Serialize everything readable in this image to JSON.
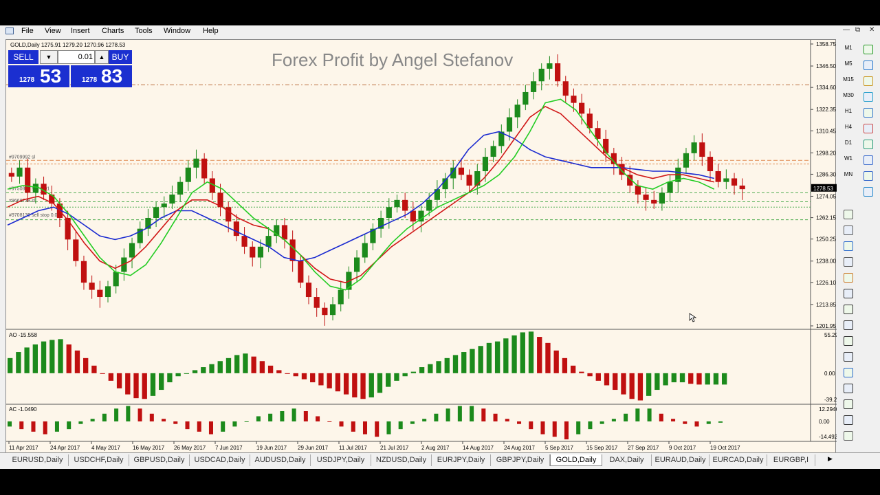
{
  "menu": {
    "items": [
      "File",
      "View",
      "Insert",
      "Charts",
      "Tools",
      "Window",
      "Help"
    ]
  },
  "symbol_header": "GOLD,Daily  1275.91 1279.20 1270.96 1278.53",
  "watermark": "Forex Profit by Angel Stefanov",
  "trade_panel": {
    "sell_label": "SELL",
    "buy_label": "BUY",
    "lot": "0.01",
    "sell_prefix": "1278",
    "sell_big": "53",
    "buy_prefix": "1278",
    "buy_big": "83"
  },
  "price_axis": [
    "1358.75",
    "1346.50",
    "1334.60",
    "1322.35",
    "1310.45",
    "1298.20",
    "1286.30",
    "1274.05",
    "1262.15",
    "1250.25",
    "1238.00",
    "1226.10",
    "1213.85",
    "1201.95"
  ],
  "current_price_label": "1278.53",
  "order_labels": [
    "#9709992 sl",
    "#9750852 sell 0.01",
    "#9668739 sl",
    "#9708139 sell stop 0.0"
  ],
  "ao": {
    "label": "AO -15.558",
    "axis": [
      "55.297",
      "0.00",
      "-39.216"
    ]
  },
  "ac": {
    "label": "AC -1.0490",
    "axis": [
      "12.2946",
      "0.00",
      "-14.4927"
    ]
  },
  "date_axis": [
    "11 Apr 2017",
    "24 Apr 2017",
    "4 May 2017",
    "16 May 2017",
    "26 May 2017",
    "7 Jun 2017",
    "19 Jun 2017",
    "29 Jun 2017",
    "11 Jul 2017",
    "21 Jul 2017",
    "2 Aug 2017",
    "14 Aug 2017",
    "24 Aug 2017",
    "5 Sep 2017",
    "15 Sep 2017",
    "27 Sep 2017",
    "9 Oct 2017",
    "19 Oct 2017"
  ],
  "timeframes": [
    "M1",
    "M5",
    "M15",
    "M30",
    "H1",
    "H4",
    "D1",
    "W1",
    "MN"
  ],
  "tabs": [
    "EURUSD,Daily",
    "USDCHF,Daily",
    "GBPUSD,Daily",
    "USDCAD,Daily",
    "AUDUSD,Daily",
    "USDJPY,Daily",
    "NZDUSD,Daily",
    "EURJPY,Daily",
    "GBPJPY,Daily",
    "GOLD,Daily",
    "DAX,Daily",
    "EURAUD,Daily",
    "EURCAD,Daily",
    "EURGBP,I"
  ],
  "active_tab": "GOLD,Daily",
  "colors": {
    "chart_bg": "#fdf6ea",
    "bull_candle": "#1c8a1c",
    "bear_candle": "#c01010",
    "ma_green": "#22cc22",
    "ma_red": "#d01818",
    "ma_blue": "#1a2ad0",
    "sell_buy_bg": "#1b2fd0"
  },
  "chart_data": {
    "type": "candlestick",
    "price_range": [
      1201.95,
      1358.75
    ],
    "closes": [
      1285,
      1290,
      1276,
      1281,
      1275,
      1270,
      1262,
      1250,
      1238,
      1226,
      1222,
      1218,
      1224,
      1232,
      1240,
      1248,
      1256,
      1262,
      1268,
      1270,
      1275,
      1282,
      1290,
      1295,
      1284,
      1276,
      1268,
      1260,
      1252,
      1246,
      1240,
      1246,
      1252,
      1258,
      1250,
      1238,
      1226,
      1218,
      1212,
      1208,
      1214,
      1222,
      1232,
      1240,
      1248,
      1256,
      1262,
      1268,
      1272,
      1266,
      1260,
      1266,
      1272,
      1278,
      1284,
      1290,
      1286,
      1280,
      1288,
      1296,
      1302,
      1310,
      1318,
      1325,
      1332,
      1338,
      1345,
      1348,
      1338,
      1330,
      1326,
      1320,
      1312,
      1306,
      1298,
      1292,
      1286,
      1280,
      1275,
      1272,
      1270,
      1276,
      1282,
      1290,
      1298,
      1304,
      1296,
      1288,
      1282,
      1284,
      1280,
      1278
    ],
    "ma_green": [
      1278,
      1280,
      1279,
      1274,
      1264,
      1252,
      1240,
      1232,
      1230,
      1236,
      1248,
      1262,
      1276,
      1282,
      1278,
      1270,
      1262,
      1256,
      1250,
      1242,
      1232,
      1224,
      1222,
      1228,
      1238,
      1248,
      1256,
      1262,
      1268,
      1272,
      1276,
      1280,
      1286,
      1296,
      1310,
      1326,
      1328,
      1322,
      1310,
      1298,
      1288,
      1280,
      1278,
      1282,
      1284,
      1282,
      1278
    ],
    "ma_red": [
      1268,
      1272,
      1274,
      1270,
      1260,
      1248,
      1238,
      1234,
      1238,
      1246,
      1256,
      1266,
      1272,
      1272,
      1268,
      1262,
      1258,
      1256,
      1250,
      1242,
      1234,
      1228,
      1226,
      1230,
      1238,
      1246,
      1252,
      1258,
      1264,
      1270,
      1276,
      1284,
      1294,
      1306,
      1318,
      1324,
      1320,
      1312,
      1304,
      1296,
      1290,
      1286,
      1284,
      1286,
      1286,
      1284,
      1282
    ],
    "ma_blue": [
      1258,
      1262,
      1266,
      1268,
      1264,
      1258,
      1252,
      1250,
      1252,
      1256,
      1262,
      1266,
      1266,
      1262,
      1258,
      1254,
      1250,
      1246,
      1240,
      1238,
      1240,
      1244,
      1248,
      1252,
      1256,
      1260,
      1264,
      1270,
      1278,
      1288,
      1300,
      1308,
      1310,
      1306,
      1300,
      1296,
      1294,
      1292,
      1290,
      1290,
      1290,
      1289,
      1288,
      1288,
      1287,
      1286,
      1284
    ],
    "ao_values": [
      20,
      28,
      34,
      38,
      42,
      44,
      45,
      38,
      30,
      20,
      10,
      0,
      -10,
      -20,
      -28,
      -33,
      -34,
      -30,
      -22,
      -12,
      -4,
      0,
      4,
      8,
      12,
      16,
      20,
      24,
      26,
      22,
      16,
      10,
      4,
      0,
      -4,
      -8,
      -12,
      -16,
      -20,
      -24,
      -28,
      -32,
      -34,
      -32,
      -26,
      -18,
      -10,
      -4,
      2,
      8,
      12,
      16,
      20,
      24,
      28,
      32,
      36,
      40,
      42,
      46,
      50,
      54,
      55,
      48,
      40,
      30,
      20,
      10,
      2,
      -4,
      -10,
      -16,
      -22,
      -28,
      -34,
      -36,
      -30,
      -22,
      -16,
      -12,
      -12,
      -14,
      -15,
      -15,
      -15,
      -15
    ],
    "ac_values": [
      -4,
      -6,
      -8,
      -10,
      -8,
      -6,
      -2,
      2,
      6,
      10,
      12,
      10,
      6,
      2,
      -2,
      -6,
      -8,
      -10,
      -8,
      -4,
      0,
      4,
      6,
      8,
      10,
      8,
      4,
      0,
      -4,
      -8,
      -10,
      -12,
      -10,
      -6,
      -2,
      2,
      6,
      10,
      12,
      12,
      10,
      6,
      2,
      -2,
      -6,
      -10,
      -12,
      -14,
      -10,
      -6,
      -2,
      2,
      6,
      10,
      10,
      6,
      2,
      -2,
      -4,
      -2,
      -1
    ]
  }
}
